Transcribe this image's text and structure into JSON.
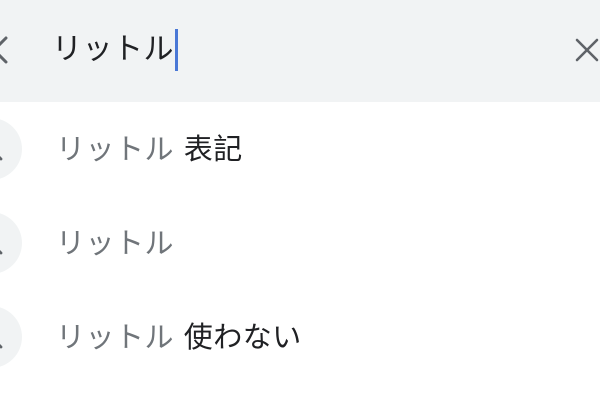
{
  "search": {
    "query": "リットル",
    "back_icon": "chevron-left-icon",
    "clear_icon": "close-icon"
  },
  "suggestions": [
    {
      "match": "リットル",
      "completion": " 表記",
      "icon": "search-icon"
    },
    {
      "match": "リットル",
      "completion": "",
      "icon": "search-icon"
    },
    {
      "match": "リットル",
      "completion": " 使わない",
      "icon": "search-icon"
    }
  ],
  "colors": {
    "search_bar_bg": "#f1f3f4",
    "caret": "#4a78d6",
    "text_primary": "#202124",
    "text_secondary": "#70757a"
  }
}
